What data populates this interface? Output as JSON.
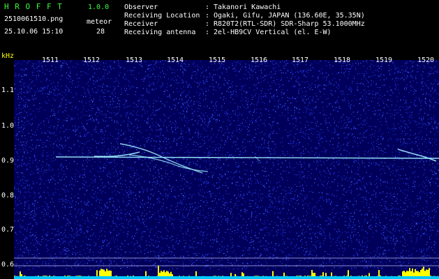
{
  "header": {
    "app_name": "H R O F F T",
    "version": "1.0.0",
    "filename": "2510061510.png",
    "datetime": "25.10.06 15:10",
    "meteor_label": "meteor",
    "meteor_count": "28",
    "info": [
      {
        "label": "Observer",
        "sep": ":",
        "value": "Takanori Kawachi"
      },
      {
        "label": "Receiving Location",
        "sep": ":",
        "value": "Ogaki, Gifu, JAPAN (136.60E, 35.35N)"
      },
      {
        "label": "Receiver",
        "sep": ":",
        "value": "R820T2(RTL-SDR) SDR-Sharp 53.1000MHz"
      },
      {
        "label": "Receiving antenna",
        "sep": ":",
        "value": "2el-HB9CV Vertical (el. E-W)"
      }
    ]
  },
  "axes": {
    "y_unit": "kHz",
    "x_ticks": [
      "1511",
      "1512",
      "1513",
      "1514",
      "1515",
      "1516",
      "1517",
      "1518",
      "1519",
      "1520"
    ],
    "y_ticks": [
      "1.1",
      "1.0",
      "0.9",
      "0.8",
      "0.7",
      "0.6"
    ]
  },
  "colors": {
    "background": "#00005a",
    "noise": "#2a3cff",
    "trace": "#9ff0ff",
    "histogram": "#ffff00",
    "baseline": "#00c8ff",
    "text_green": "#3cff3c",
    "text_yellow": "#ffff00"
  }
}
